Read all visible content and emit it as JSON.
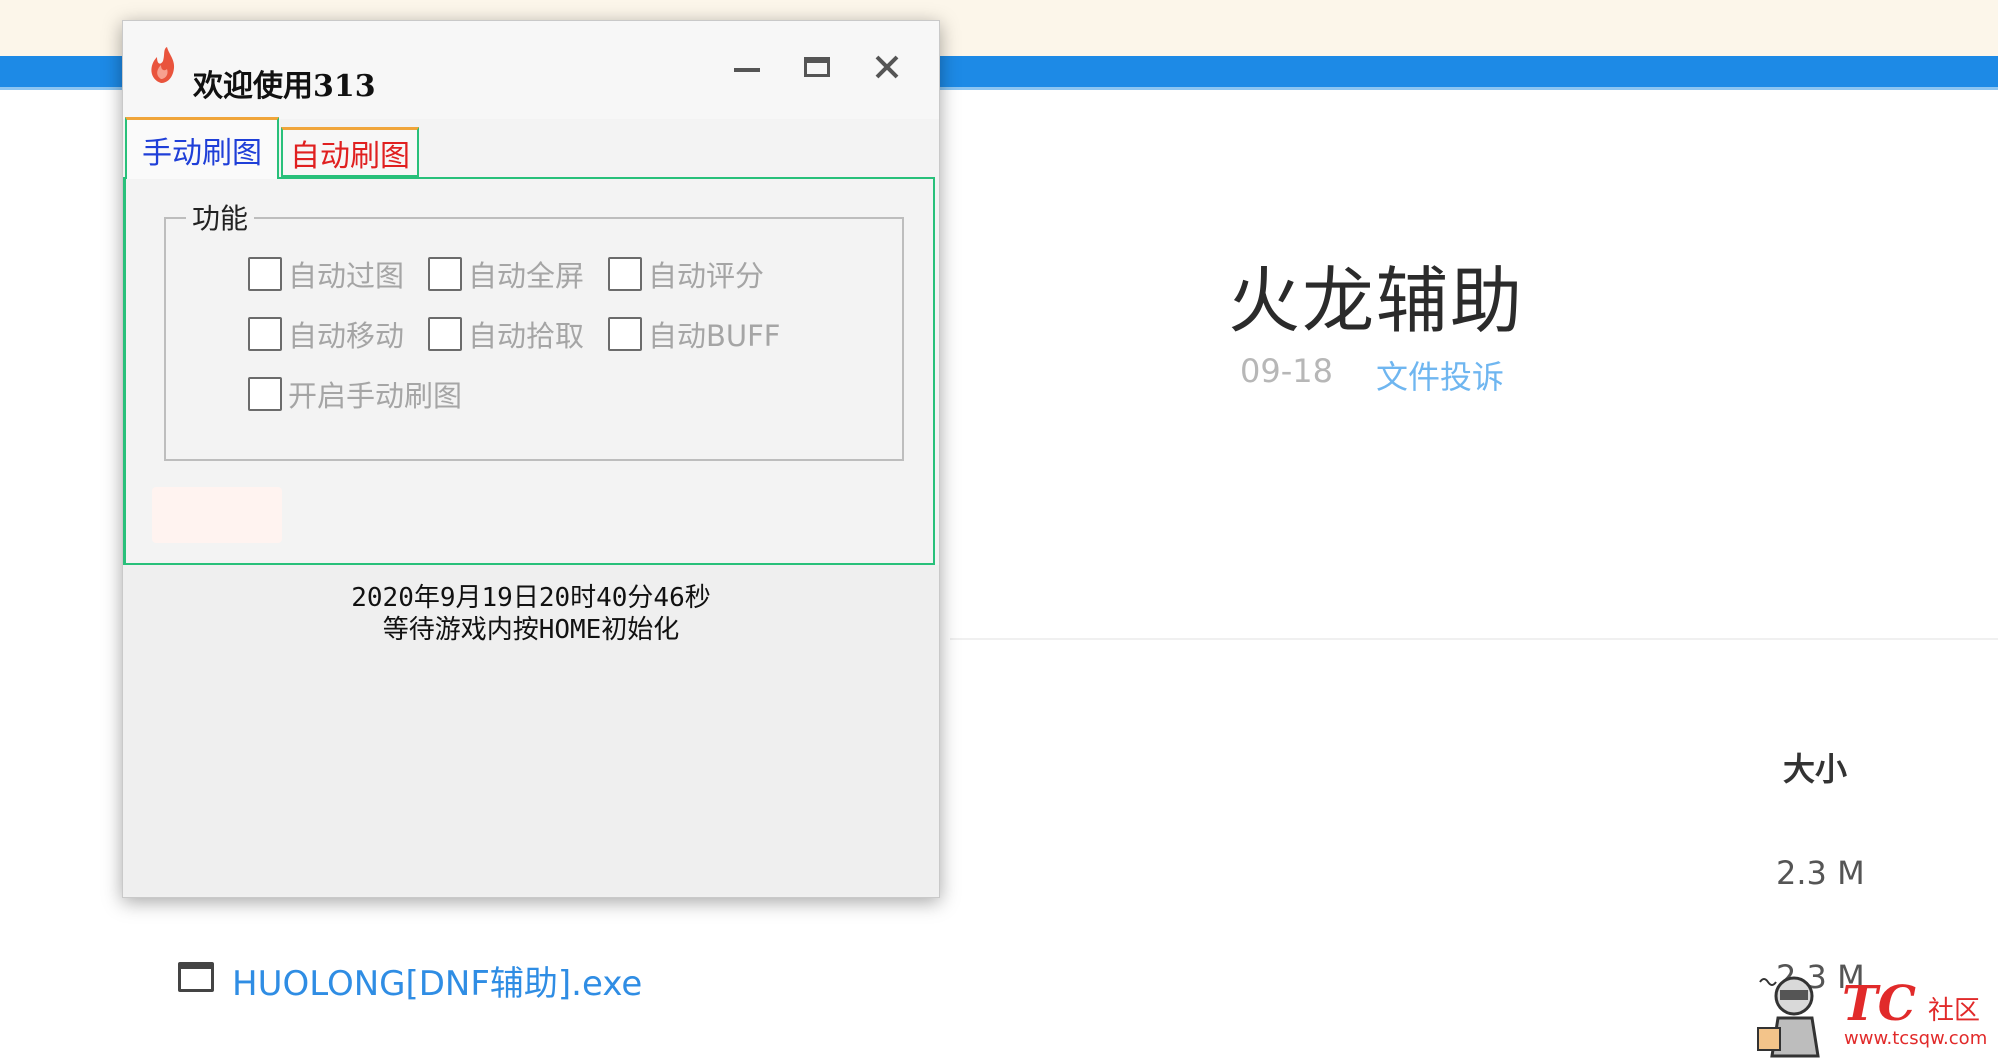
{
  "page": {
    "title": "火龙辅助",
    "date": "09-18",
    "complain_link": "文件投诉",
    "size_header": "大小",
    "sizes": [
      "2.3 M",
      "2.3 M"
    ],
    "file_name": "HUOLONG[DNF辅助].exe"
  },
  "watermark": {
    "brand": "TC",
    "club": "社区",
    "url": "www.tcsqw.com"
  },
  "dialog": {
    "title": "欢迎使用313",
    "tabs": [
      {
        "label": "手动刷图",
        "active": true
      },
      {
        "label": "自动刷图",
        "active": false
      }
    ],
    "group_label": "功能",
    "checkboxes": [
      {
        "label": "自动过图",
        "checked": false
      },
      {
        "label": "自动全屏",
        "checked": false
      },
      {
        "label": "自动评分",
        "checked": false
      },
      {
        "label": "自动移动",
        "checked": false
      },
      {
        "label": "自动拾取",
        "checked": false
      },
      {
        "label": "自动BUFF",
        "checked": false
      },
      {
        "label": "开启手动刷图",
        "checked": false
      }
    ],
    "status_lines": [
      "2020年9月19日20时40分46秒",
      "等待游戏内按HOME初始化"
    ]
  },
  "colors": {
    "accent_blue": "#1d8ae6",
    "tab_active_text": "#1f3fd8",
    "tab_inactive_text": "#e02020",
    "tab_border": "#28c07a",
    "link": "#2f8de4",
    "watermark": "#e12a2a"
  },
  "icons": {
    "app": "flame-icon",
    "minimize": "minimize-icon",
    "maximize": "maximize-icon",
    "close": "close-icon",
    "file": "window-file-icon"
  }
}
